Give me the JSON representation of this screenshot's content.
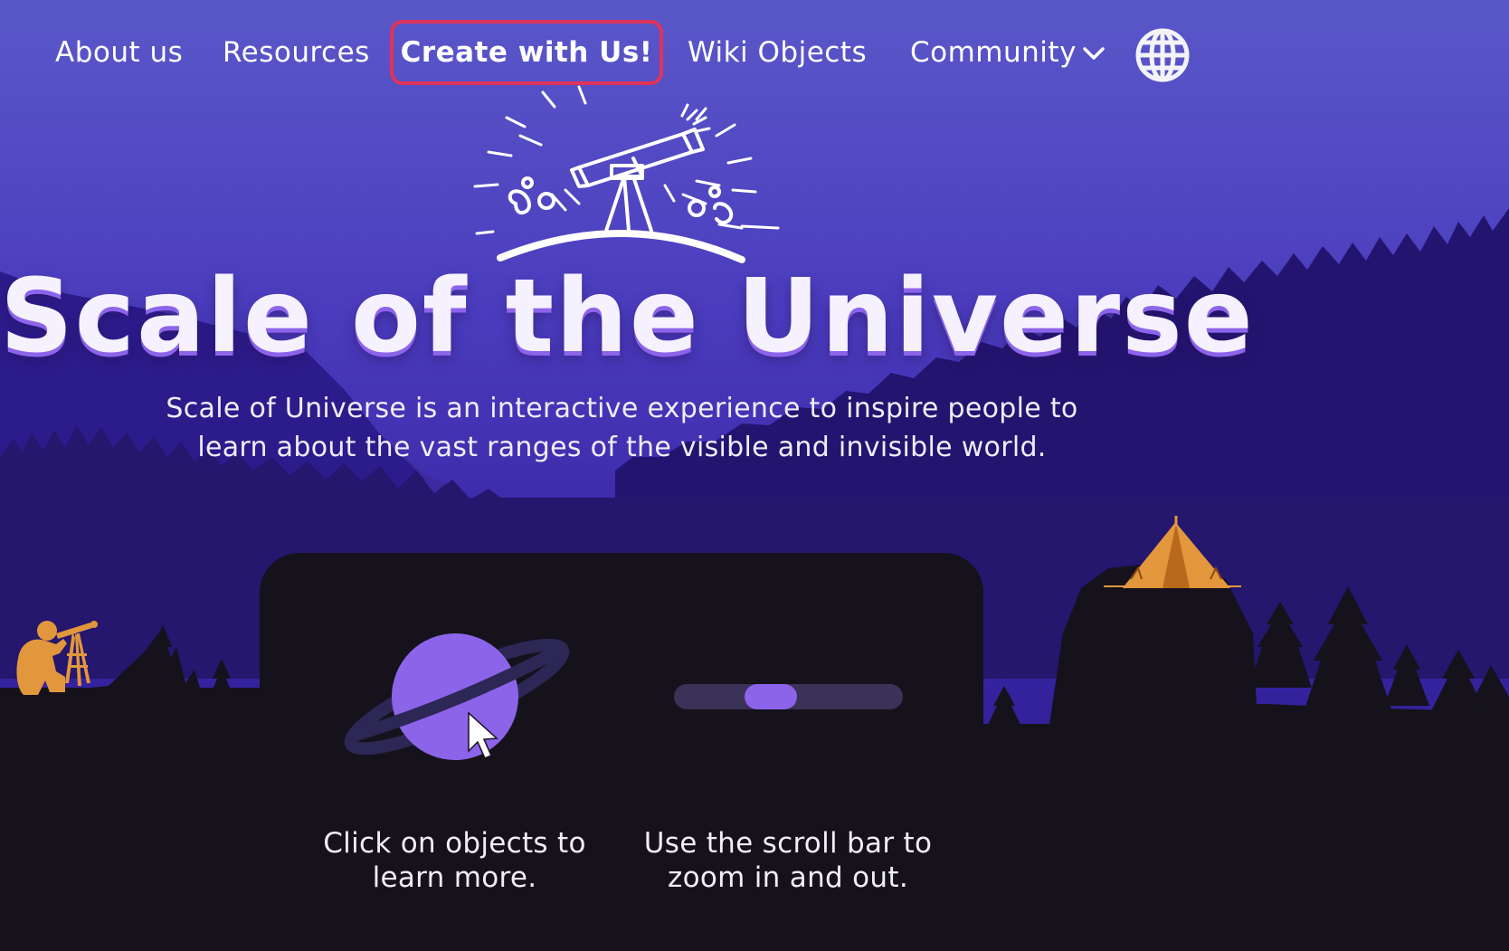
{
  "nav": {
    "about": "About us",
    "resources": "Resources",
    "create": "Create with Us!",
    "wiki": "Wiki Objects",
    "community": "Community"
  },
  "hero": {
    "title": "Scale of the Universe",
    "description": "Scale of Universe is an interactive experience to inspire people to learn about the vast ranges of the visible and invisible world."
  },
  "tips": {
    "click": "Click on objects to learn more.",
    "scroll": "Use the scroll bar to zoom in and out."
  },
  "scroll_position": 0.4,
  "colors": {
    "sky_top": "#5a55c8",
    "sky_mid": "#3d2aa8",
    "accent_purple": "#8c64ea",
    "highlight_border": "#e0335a",
    "ground": "#15121c",
    "orange": "#e3973c"
  },
  "icons": [
    "globe-icon",
    "chevron-down-icon",
    "telescope-icon",
    "planet-icon",
    "cursor-icon",
    "tent-icon",
    "stargazer-icon"
  ]
}
